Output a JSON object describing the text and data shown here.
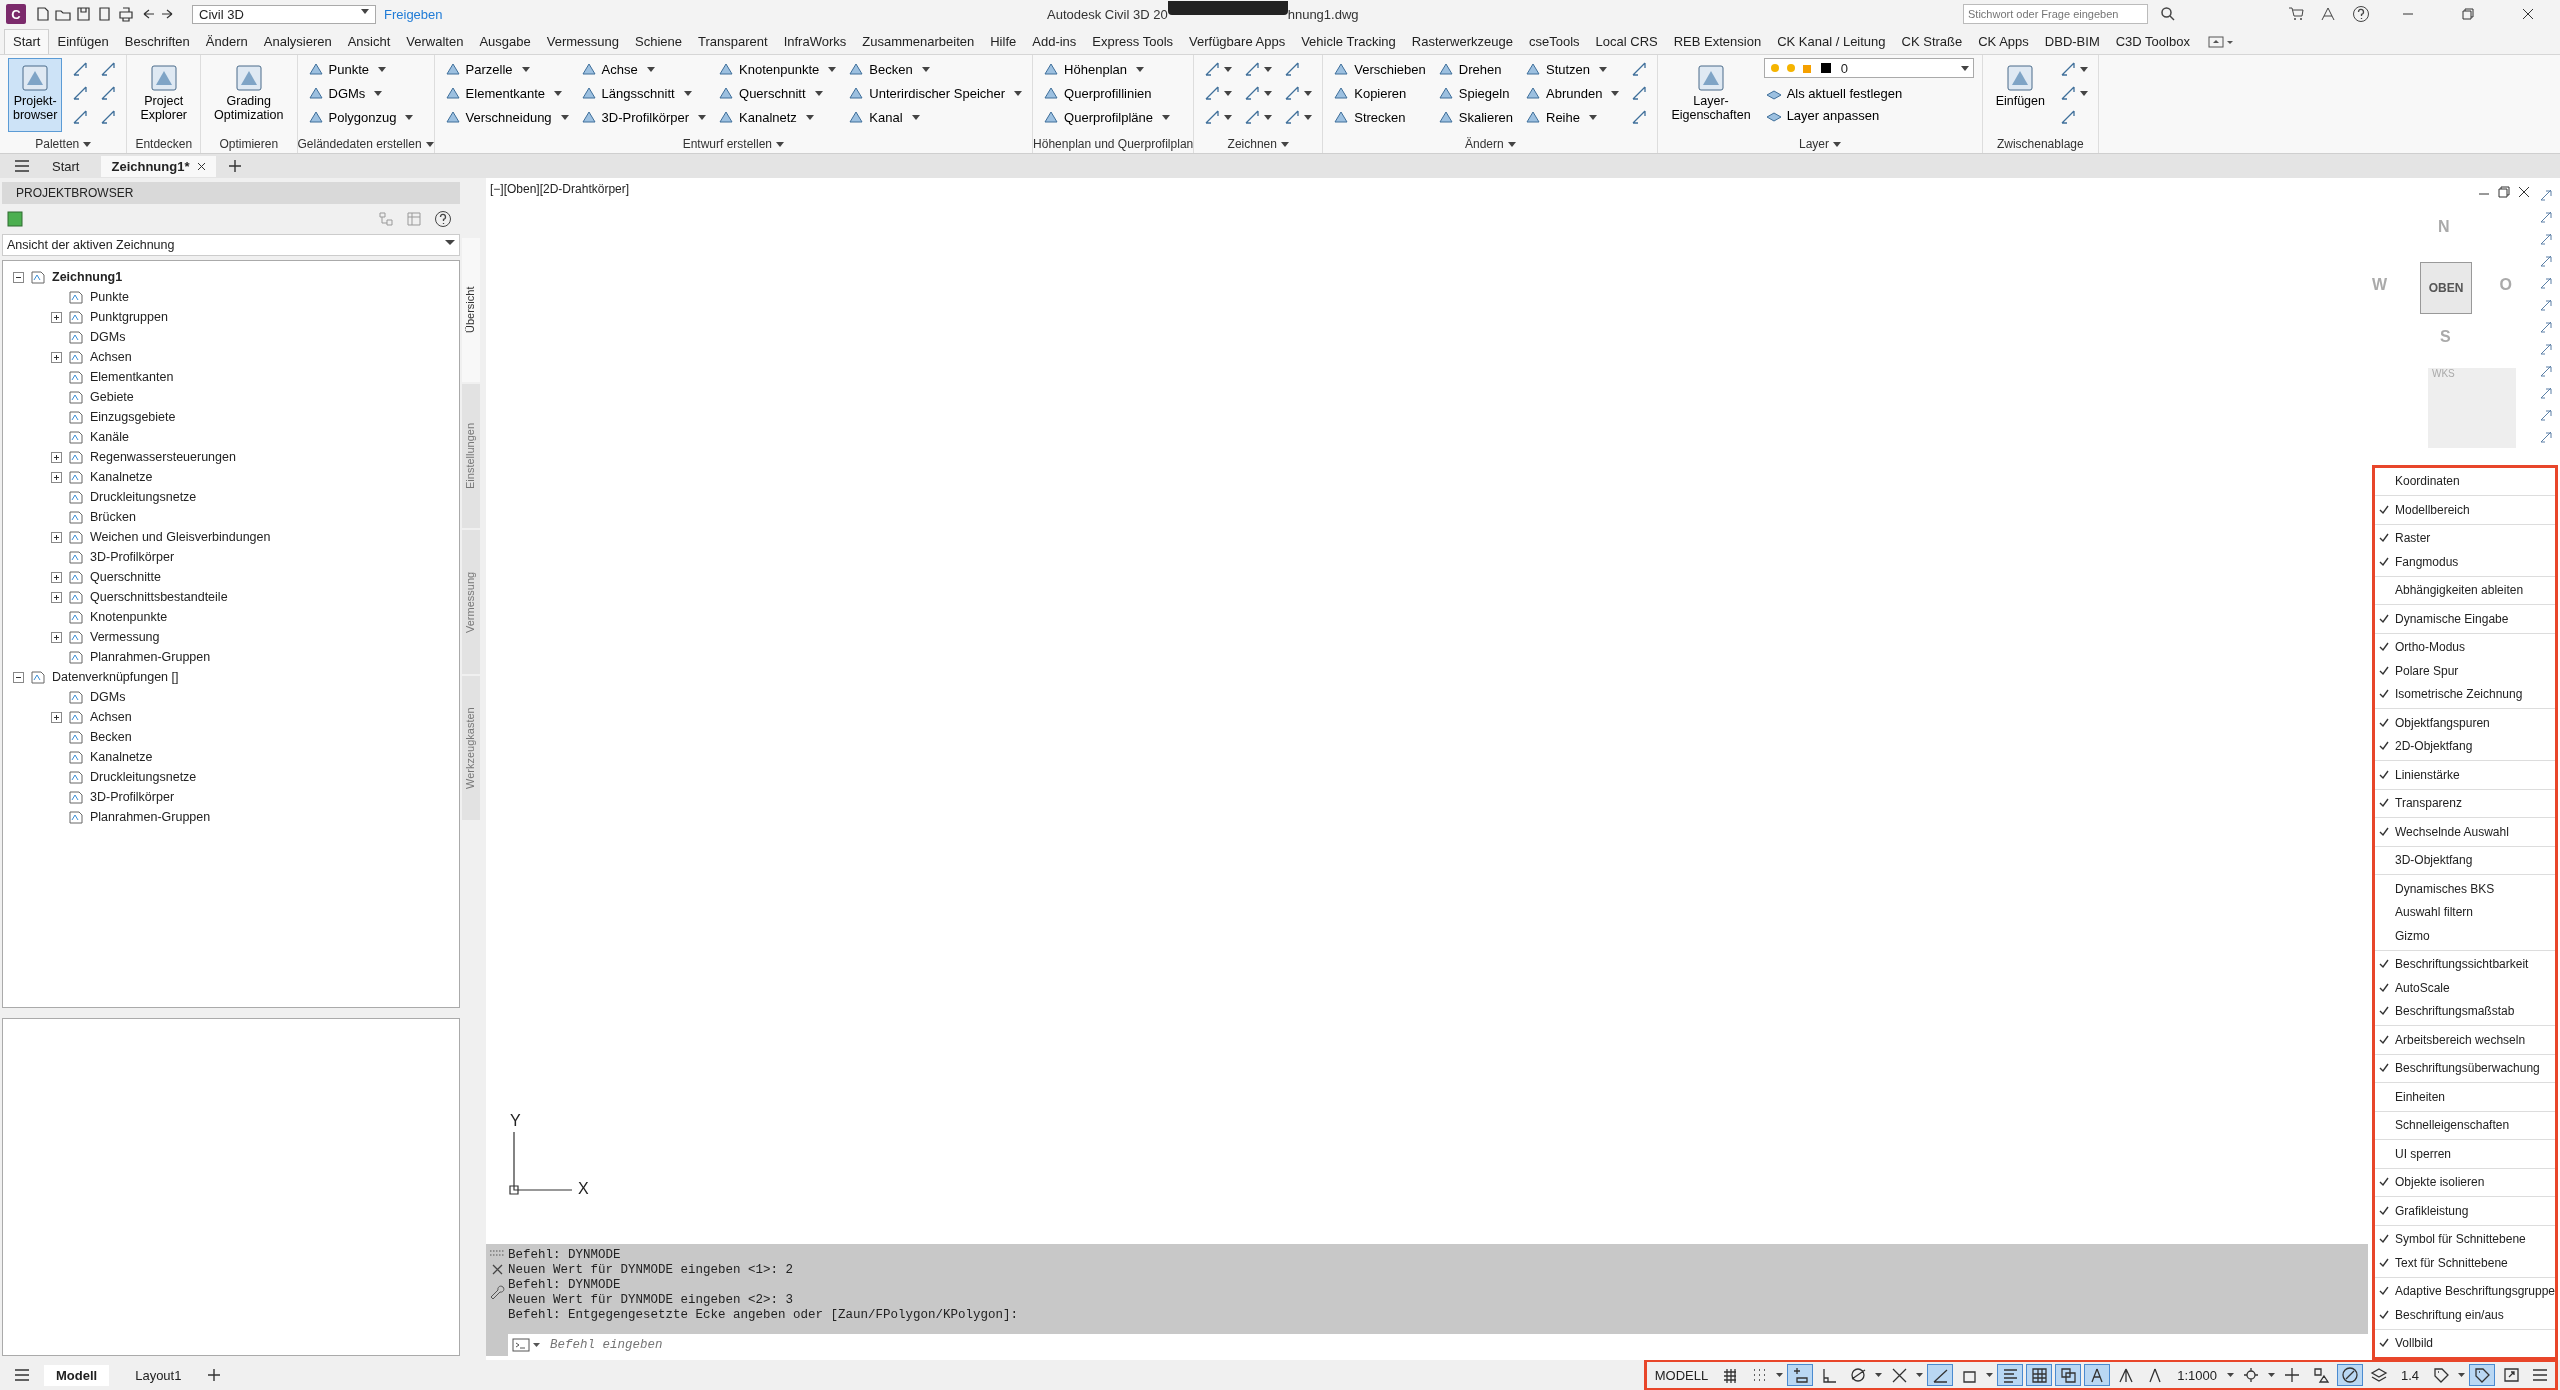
{
  "title_bar": {
    "app_letter": "C",
    "workspace": "Civil 3D",
    "share": "Freigeben",
    "title_left": "Autodesk Civil 3D 20",
    "title_right": "hnung1.dwg",
    "search": {
      "placeholder": "Stichwort oder Frage eingeben"
    }
  },
  "menu_tabs": [
    {
      "label": "Start",
      "selected": true
    },
    {
      "label": "Einfügen",
      "selected": false
    },
    {
      "label": "Beschriften",
      "selected": false
    },
    {
      "label": "Ändern",
      "selected": false
    },
    {
      "label": "Analysieren",
      "selected": false
    },
    {
      "label": "Ansicht",
      "selected": false
    },
    {
      "label": "Verwalten",
      "selected": false
    },
    {
      "label": "Ausgabe",
      "selected": false
    },
    {
      "label": "Vermessung",
      "selected": false
    },
    {
      "label": "Schiene",
      "selected": false
    },
    {
      "label": "Transparent",
      "selected": false
    },
    {
      "label": "InfraWorks",
      "selected": false
    },
    {
      "label": "Zusammenarbeiten",
      "selected": false
    },
    {
      "label": "Hilfe",
      "selected": false
    },
    {
      "label": "Add-ins",
      "selected": false
    },
    {
      "label": "Express Tools",
      "selected": false
    },
    {
      "label": "Verfügbare Apps",
      "selected": false
    },
    {
      "label": "Vehicle Tracking",
      "selected": false
    },
    {
      "label": "Rasterwerkzeuge",
      "selected": false
    },
    {
      "label": "cseTools",
      "selected": false
    },
    {
      "label": "Local CRS",
      "selected": false
    },
    {
      "label": "REB Extension",
      "selected": false
    },
    {
      "label": "CK Kanal / Leitung",
      "selected": false
    },
    {
      "label": "CK Straße",
      "selected": false
    },
    {
      "label": "CK Apps",
      "selected": false
    },
    {
      "label": "DBD-BIM",
      "selected": false
    },
    {
      "label": "C3D Toolbox",
      "selected": false
    }
  ],
  "ribbon": [
    {
      "title": "Paletten",
      "dropdown": true,
      "columns": [
        {
          "kind": "large",
          "items": [
            {
              "label": "Projekt-\nbrowser",
              "selected": true
            }
          ]
        },
        {
          "kind": "icons",
          "items": [
            {
              "dropdown": false
            },
            {
              "dropdown": false
            },
            {
              "dropdown": false
            }
          ]
        },
        {
          "kind": "icons",
          "items": [
            {
              "dropdown": false
            },
            {
              "dropdown": false
            },
            {
              "dropdown": false
            }
          ]
        }
      ]
    },
    {
      "title": "Entdecken",
      "dropdown": false,
      "columns": [
        {
          "kind": "large",
          "items": [
            {
              "label": "Project\nExplorer",
              "selected": false
            }
          ]
        }
      ]
    },
    {
      "title": "Optimieren",
      "dropdown": false,
      "columns": [
        {
          "kind": "large",
          "items": [
            {
              "label": "Grading\nOptimization",
              "selected": false
            }
          ]
        }
      ]
    },
    {
      "title": "Geländedaten erstellen",
      "dropdown": true,
      "columns": [
        {
          "kind": "small",
          "items": [
            {
              "label": "Punkte",
              "dropdown": true
            },
            {
              "label": "DGMs",
              "dropdown": true
            },
            {
              "label": "Polygonzug",
              "dropdown": true
            }
          ]
        }
      ]
    },
    {
      "title": "Entwurf erstellen",
      "dropdown": true,
      "columns": [
        {
          "kind": "small",
          "items": [
            {
              "label": "Parzelle",
              "dropdown": true
            },
            {
              "label": "Elementkante",
              "dropdown": true
            },
            {
              "label": "Verschneidung",
              "dropdown": true
            }
          ]
        },
        {
          "kind": "small",
          "items": [
            {
              "label": "Achse",
              "dropdown": true
            },
            {
              "label": "Längsschnitt",
              "dropdown": true
            },
            {
              "label": "3D-Profilkörper",
              "dropdown": true
            }
          ]
        },
        {
          "kind": "small",
          "items": [
            {
              "label": "Knotenpunkte",
              "dropdown": true
            },
            {
              "label": "Querschnitt",
              "dropdown": true
            },
            {
              "label": "Kanalnetz",
              "dropdown": true
            }
          ]
        },
        {
          "kind": "small",
          "items": [
            {
              "label": "Becken",
              "dropdown": true
            },
            {
              "label": "Unterirdischer Speicher",
              "dropdown": true
            },
            {
              "label": "Kanal",
              "dropdown": true
            }
          ]
        }
      ]
    },
    {
      "title": "Höhenplan und Querprofilplan",
      "dropdown": false,
      "columns": [
        {
          "kind": "small",
          "items": [
            {
              "label": "Höhenplan",
              "dropdown": true
            },
            {
              "label": "Querprofillinien",
              "dropdown": false
            },
            {
              "label": "Querprofilpläne",
              "dropdown": true
            }
          ]
        }
      ]
    },
    {
      "title": "Zeichnen",
      "dropdown": true,
      "columns": [
        {
          "kind": "icons",
          "items": [
            {
              "dropdown": true
            },
            {
              "dropdown": true
            },
            {
              "dropdown": true
            }
          ]
        },
        {
          "kind": "icons",
          "items": [
            {
              "dropdown": true
            },
            {
              "dropdown": true
            },
            {
              "dropdown": true
            }
          ]
        },
        {
          "kind": "icons",
          "items": [
            {
              "dropdown": false
            },
            {
              "dropdown": true
            },
            {
              "dropdown": true
            }
          ]
        }
      ]
    },
    {
      "title": "Ändern",
      "dropdown": true,
      "columns": [
        {
          "kind": "small",
          "items": [
            {
              "label": "Verschieben",
              "dropdown": false
            },
            {
              "label": "Kopieren",
              "dropdown": false
            },
            {
              "label": "Strecken",
              "dropdown": false
            }
          ]
        },
        {
          "kind": "small",
          "items": [
            {
              "label": "Drehen",
              "dropdown": false
            },
            {
              "label": "Spiegeln",
              "dropdown": false
            },
            {
              "label": "Skalieren",
              "dropdown": false
            }
          ]
        },
        {
          "kind": "small",
          "items": [
            {
              "label": "Stutzen",
              "dropdown": true
            },
            {
              "label": "Abrunden",
              "dropdown": true
            },
            {
              "label": "Reihe",
              "dropdown": true
            }
          ]
        },
        {
          "kind": "icons",
          "items": [
            {
              "dropdown": false
            },
            {
              "dropdown": false
            },
            {
              "dropdown": false
            }
          ]
        }
      ]
    },
    {
      "title": "Layer",
      "dropdown": true,
      "columns": [
        {
          "kind": "large",
          "items": [
            {
              "label": "Layer-\nEigenschaften",
              "selected": false
            }
          ]
        },
        {
          "kind": "layer",
          "layer": "0",
          "items": [
            {
              "label": "Als aktuell festlegen",
              "dropdown": false
            },
            {
              "label": "Layer anpassen",
              "dropdown": false
            }
          ]
        }
      ]
    },
    {
      "title": "Zwischenablage",
      "dropdown": false,
      "columns": [
        {
          "kind": "large",
          "items": [
            {
              "label": "Einfügen",
              "selected": false
            }
          ]
        },
        {
          "kind": "icons",
          "items": [
            {
              "dropdown": true
            },
            {
              "dropdown": true
            },
            {
              "dropdown": false
            }
          ]
        }
      ]
    }
  ],
  "doc_tabs": [
    {
      "label": "Start",
      "selected": false,
      "closable": false
    },
    {
      "label": "Zeichnung1*",
      "selected": true,
      "closable": true
    }
  ],
  "browser": {
    "title": "PROJEKTBROWSER",
    "view": "Ansicht der aktiven Zeichnung",
    "tree": [
      {
        "label": "Zeichnung1",
        "bold": true,
        "expandable": true,
        "expanded": true,
        "children": [
          {
            "label": "Punkte",
            "bold": false,
            "expandable": false
          },
          {
            "label": "Punktgruppen",
            "bold": false,
            "expandable": true,
            "expanded": false
          },
          {
            "label": "DGMs",
            "bold": false,
            "expandable": false
          },
          {
            "label": "Achsen",
            "bold": false,
            "expandable": true,
            "expanded": false
          },
          {
            "label": "Elementkanten",
            "bold": false,
            "expandable": false
          },
          {
            "label": "Gebiete",
            "bold": false,
            "expandable": false
          },
          {
            "label": "Einzugsgebiete",
            "bold": false,
            "expandable": false
          },
          {
            "label": "Kanäle",
            "bold": false,
            "expandable": false
          },
          {
            "label": "Regenwassersteuerungen",
            "bold": false,
            "expandable": true,
            "expanded": false
          },
          {
            "label": "Kanalnetze",
            "bold": false,
            "expandable": true,
            "expanded": false
          },
          {
            "label": "Druckleitungsnetze",
            "bold": false,
            "expandable": false
          },
          {
            "label": "Brücken",
            "bold": false,
            "expandable": false
          },
          {
            "label": "Weichen und Gleisverbindungen",
            "bold": false,
            "expandable": true,
            "expanded": false
          },
          {
            "label": "3D-Profilkörper",
            "bold": false,
            "expandable": false
          },
          {
            "label": "Querschnitte",
            "bold": false,
            "expandable": true,
            "expanded": false
          },
          {
            "label": "Querschnittsbestandteile",
            "bold": false,
            "expandable": true,
            "expanded": false
          },
          {
            "label": "Knotenpunkte",
            "bold": false,
            "expandable": false
          },
          {
            "label": "Vermessung",
            "bold": false,
            "expandable": true,
            "expanded": false
          },
          {
            "label": "Planrahmen-Gruppen",
            "bold": false,
            "expandable": false
          }
        ]
      },
      {
        "label": "Datenverknüpfungen []",
        "bold": false,
        "expandable": true,
        "expanded": true,
        "children": [
          {
            "label": "DGMs",
            "bold": false,
            "expandable": false
          },
          {
            "label": "Achsen",
            "bold": false,
            "expandable": true,
            "expanded": false
          },
          {
            "label": "Becken",
            "bold": false,
            "expandable": false
          },
          {
            "label": "Kanalnetze",
            "bold": false,
            "expandable": false
          },
          {
            "label": "Druckleitungsnetze",
            "bold": false,
            "expandable": false
          },
          {
            "label": "3D-Profilkörper",
            "bold": false,
            "expandable": false
          },
          {
            "label": "Planrahmen-Gruppen",
            "bold": false,
            "expandable": false
          }
        ]
      }
    ],
    "side_tabs": [
      {
        "label": "Übersicht",
        "selected": true
      },
      {
        "label": "Einstellungen",
        "selected": false
      },
      {
        "label": "Vermessung",
        "selected": false
      },
      {
        "label": "Werkzeugkasten",
        "selected": false
      }
    ]
  },
  "viewport": {
    "label": "[−][Oben][2D-Drahtkörper]",
    "viewcube": {
      "north": "N",
      "south": "S",
      "west": "W",
      "east": "O",
      "face": "OBEN",
      "ucs": "WKS"
    },
    "ucs_icon": {
      "y": "Y",
      "x": "X"
    }
  },
  "command_line": {
    "history": [
      "Befehl: DYNMODE",
      "Neuen Wert für DYNMODE eingeben <1>: 2",
      "Befehl: DYNMODE",
      "Neuen Wert für DYNMODE eingeben <2>: 3",
      "Befehl: Entgegengesetzte Ecke angeben oder [Zaun/FPolygon/KPolygon]:"
    ],
    "placeholder": "Befehl eingeben"
  },
  "customize_menu": {
    "groups": [
      [
        {
          "label": "Koordinaten",
          "checked": false
        }
      ],
      [
        {
          "label": "Modellbereich",
          "checked": true
        }
      ],
      [
        {
          "label": "Raster",
          "checked": true
        },
        {
          "label": "Fangmodus",
          "checked": true
        }
      ],
      [
        {
          "label": "Abhängigkeiten ableiten",
          "checked": false
        }
      ],
      [
        {
          "label": "Dynamische Eingabe",
          "checked": true
        }
      ],
      [
        {
          "label": "Ortho-Modus",
          "checked": true
        },
        {
          "label": "Polare Spur",
          "checked": true
        },
        {
          "label": "Isometrische Zeichnung",
          "checked": true
        }
      ],
      [
        {
          "label": "Objektfangspuren",
          "checked": true
        },
        {
          "label": "2D-Objektfang",
          "checked": true
        }
      ],
      [
        {
          "label": "Linienstärke",
          "checked": true
        }
      ],
      [
        {
          "label": "Transparenz",
          "checked": true
        }
      ],
      [
        {
          "label": "Wechselnde Auswahl",
          "checked": true
        }
      ],
      [
        {
          "label": "3D-Objektfang",
          "checked": false
        }
      ],
      [
        {
          "label": "Dynamisches BKS",
          "checked": false
        },
        {
          "label": "Auswahl filtern",
          "checked": false
        },
        {
          "label": "Gizmo",
          "checked": false
        }
      ],
      [
        {
          "label": "Beschriftungssichtbarkeit",
          "checked": true
        },
        {
          "label": "AutoScale",
          "checked": true
        },
        {
          "label": "Beschriftungsmaßstab",
          "checked": true
        }
      ],
      [
        {
          "label": "Arbeitsbereich wechseln",
          "checked": true
        }
      ],
      [
        {
          "label": "Beschriftungsüberwachung",
          "checked": true
        }
      ],
      [
        {
          "label": "Einheiten",
          "checked": false
        }
      ],
      [
        {
          "label": "Schnelleigenschaften",
          "checked": false
        }
      ],
      [
        {
          "label": "UI sperren",
          "checked": false
        }
      ],
      [
        {
          "label": "Objekte isolieren",
          "checked": true
        }
      ],
      [
        {
          "label": "Grafikleistung",
          "checked": true
        }
      ],
      [
        {
          "label": "Symbol für Schnittebene",
          "checked": true
        },
        {
          "label": "Text für Schnittebene",
          "checked": true
        }
      ],
      [
        {
          "label": "Adaptive Beschriftungsgruppe",
          "checked": true
        },
        {
          "label": "Beschriftung ein/aus",
          "checked": true
        }
      ],
      [
        {
          "label": "Vollbild",
          "checked": true
        }
      ]
    ]
  },
  "layout_tabs": [
    {
      "label": "Modell",
      "selected": true
    },
    {
      "label": "Layout1",
      "selected": false
    }
  ],
  "status_bar": [
    {
      "kind": "text",
      "label": "MODELL",
      "on": false
    },
    {
      "kind": "grid",
      "on": false
    },
    {
      "kind": "dots",
      "on": false
    },
    {
      "kind": "caret"
    },
    {
      "kind": "infer",
      "on": true
    },
    {
      "kind": "ortho",
      "on": false
    },
    {
      "kind": "polar",
      "on": false
    },
    {
      "kind": "caret"
    },
    {
      "kind": "iso",
      "on": false
    },
    {
      "kind": "caret"
    },
    {
      "kind": "track",
      "on": true
    },
    {
      "kind": "osnap",
      "on": false
    },
    {
      "kind": "caret"
    },
    {
      "kind": "lineweight",
      "on": true
    },
    {
      "kind": "transparency",
      "on": true
    },
    {
      "kind": "cycle",
      "on": true
    },
    {
      "kind": "annovis",
      "on": true
    },
    {
      "kind": "autoscale",
      "on": false
    },
    {
      "kind": "annoscale",
      "on": false
    },
    {
      "kind": "text",
      "label": "1:1000",
      "on": false
    },
    {
      "kind": "caret"
    },
    {
      "kind": "gear",
      "on": false
    },
    {
      "kind": "caret"
    },
    {
      "kind": "plus",
      "on": false
    },
    {
      "kind": "shapes",
      "on": false
    },
    {
      "kind": "isolate",
      "on": true
    },
    {
      "kind": "layers",
      "on": false
    },
    {
      "kind": "text",
      "label": "1.4",
      "on": false
    },
    {
      "kind": "tag",
      "on": false
    },
    {
      "kind": "caret"
    },
    {
      "kind": "tag",
      "on": true
    },
    {
      "kind": "fullscreen",
      "on": false
    },
    {
      "kind": "menu",
      "on": false
    }
  ]
}
